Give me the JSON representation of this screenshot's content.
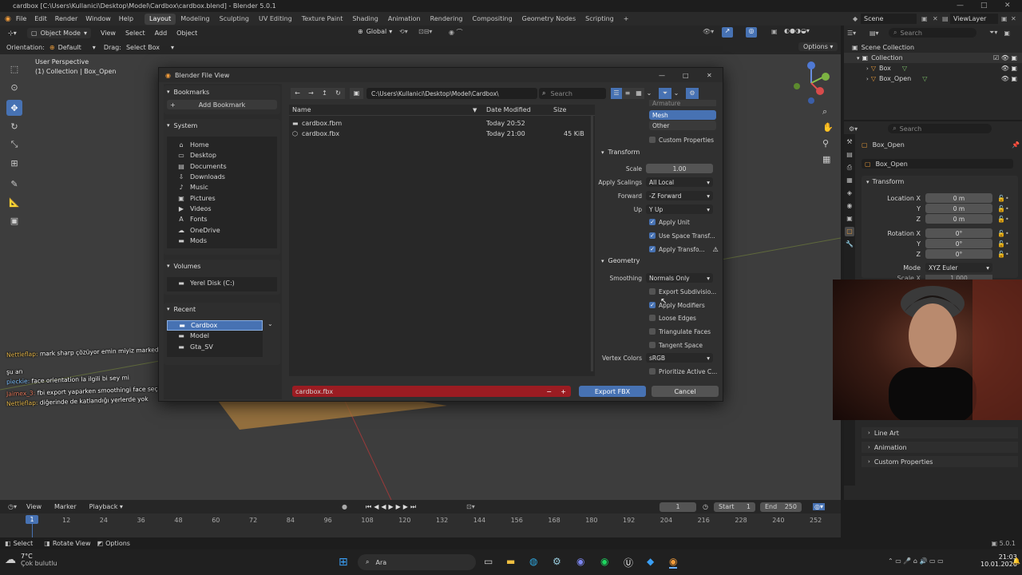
{
  "window": {
    "title": "cardbox [C:\\Users\\Kullanici\\Desktop\\Model\\Cardbox\\cardbox.blend] - Blender 5.0.1"
  },
  "menu": {
    "items": [
      "File",
      "Edit",
      "Render",
      "Window",
      "Help"
    ],
    "workspaces": [
      "Layout",
      "Modeling",
      "Sculpting",
      "UV Editing",
      "Texture Paint",
      "Shading",
      "Animation",
      "Rendering",
      "Compositing",
      "Geometry Nodes",
      "Scripting"
    ],
    "active_workspace": "Layout",
    "add_tab": "+",
    "scene": "Scene",
    "view_layer": "ViewLayer"
  },
  "viewport_header": {
    "mode": "Object Mode",
    "view": "View",
    "select": "Select",
    "add": "Add",
    "object": "Object",
    "transform": "Global"
  },
  "tool_header": {
    "orientation_label": "Orientation:",
    "orientation": "Default",
    "drag_label": "Drag:",
    "drag": "Select Box",
    "options": "Options"
  },
  "viewport": {
    "perspective": "User Perspective",
    "collection": "(1) Collection | Box_Open"
  },
  "outliner": {
    "search_placeholder": "Search",
    "root": "Scene Collection",
    "collection": "Collection",
    "items": [
      "Box",
      "Box_Open"
    ]
  },
  "properties": {
    "search_placeholder": "Search",
    "object_name": "Box_Open",
    "data_name": "Box_Open",
    "transform_title": "Transform",
    "location_label": "Location X",
    "rotation_label": "Rotation X",
    "axis_y": "Y",
    "axis_z": "Z",
    "loc": [
      "0 m",
      "0 m",
      "0 m"
    ],
    "rot": [
      "0°",
      "0°",
      "0°"
    ],
    "mode_label": "Mode",
    "mode": "XYZ Euler",
    "scale_label": "Scale X",
    "scale_x": "1.000",
    "panels": [
      "Line Art",
      "Animation",
      "Custom Properties"
    ]
  },
  "dialog": {
    "title": "Blender File View",
    "bookmarks": "Bookmarks",
    "add_bookmark": "Add Bookmark",
    "system": "System",
    "system_items": [
      {
        "label": "Home",
        "icon": "⌂"
      },
      {
        "label": "Desktop",
        "icon": "▭"
      },
      {
        "label": "Documents",
        "icon": "▤"
      },
      {
        "label": "Downloads",
        "icon": "⇩"
      },
      {
        "label": "Music",
        "icon": "♪"
      },
      {
        "label": "Pictures",
        "icon": "▣"
      },
      {
        "label": "Videos",
        "icon": "▶"
      },
      {
        "label": "Fonts",
        "icon": "A"
      },
      {
        "label": "OneDrive",
        "icon": "☁"
      },
      {
        "label": "Mods",
        "icon": "▬"
      }
    ],
    "volumes": "Volumes",
    "volume_item": "Yerel Disk (C:)",
    "recent": "Recent",
    "recent_items": [
      "Cardbox",
      "Model",
      "Gta_SV"
    ],
    "path": "C:\\Users\\Kullanici\\Desktop\\Model\\Cardbox\\",
    "search_placeholder": "Search",
    "col_name": "Name",
    "col_date": "Date Modified",
    "col_size": "Size",
    "files": [
      {
        "name": "cardbox.fbm",
        "date": "Today 20:52",
        "size": ""
      },
      {
        "name": "cardbox.fbx",
        "date": "Today 21:00",
        "size": "45 KiB"
      }
    ],
    "filename": "cardbox.fbx",
    "export_button": "Export FBX",
    "cancel_button": "Cancel",
    "options": {
      "partial_item": "Armature",
      "mesh": "Mesh",
      "other": "Other",
      "custom_props": "Custom Properties",
      "transform": "Transform",
      "scale_label": "Scale",
      "scale": "1.00",
      "apply_scalings_label": "Apply Scalings",
      "apply_scalings": "All Local",
      "forward_label": "Forward",
      "forward": "-Z Forward",
      "up_label": "Up",
      "up": "Y Up",
      "apply_unit": "Apply Unit",
      "use_space": "Use Space Transf...",
      "apply_transform": "Apply Transfo...",
      "geometry": "Geometry",
      "smoothing_label": "Smoothing",
      "smoothing": "Normals Only",
      "export_subdiv": "Export Subdivisio...",
      "apply_modifiers": "Apply Modifiers",
      "loose_edges": "Loose Edges",
      "triangulate": "Triangulate Faces",
      "tangent": "Tangent Space",
      "vertex_colors_label": "Vertex Colors",
      "vertex_colors": "sRGB",
      "prioritize": "Prioritize Active C..."
    }
  },
  "chat": [
    {
      "user": "Nettleflap:",
      "msg": "mark sharp çözüyor emin miyiz marked olduğuna"
    },
    {
      "user": "",
      "msg": "şu an"
    },
    {
      "user": "pieckie:",
      "msg": "face orientation la ilgili bi sey mi"
    },
    {
      "user": "Jaimex_3:",
      "msg": "fbi export yaparken smoothingi face seçiyor mu"
    },
    {
      "user": "Nettleflap:",
      "msg": "diğerinde de katlandığı yerlerde yok"
    }
  ],
  "timeline": {
    "view": "View",
    "marker": "Marker",
    "playback": "Playback",
    "frame": "1",
    "start_label": "Start",
    "start": "1",
    "end_label": "End",
    "end": "250",
    "ticks": [
      "12",
      "24",
      "36",
      "48",
      "60",
      "72",
      "84",
      "96",
      "108",
      "120",
      "132",
      "144",
      "156",
      "168",
      "180",
      "192",
      "204",
      "216",
      "228",
      "240",
      "252"
    ],
    "current": "1"
  },
  "status": {
    "select": "Select",
    "rotate": "Rotate View",
    "options": "Options",
    "version": "5.0.1"
  },
  "taskbar": {
    "weather_temp": "7°C",
    "weather_desc": "Çok bulutlu",
    "search": "Ara",
    "time": "21:03",
    "date": "10.01.2026"
  }
}
